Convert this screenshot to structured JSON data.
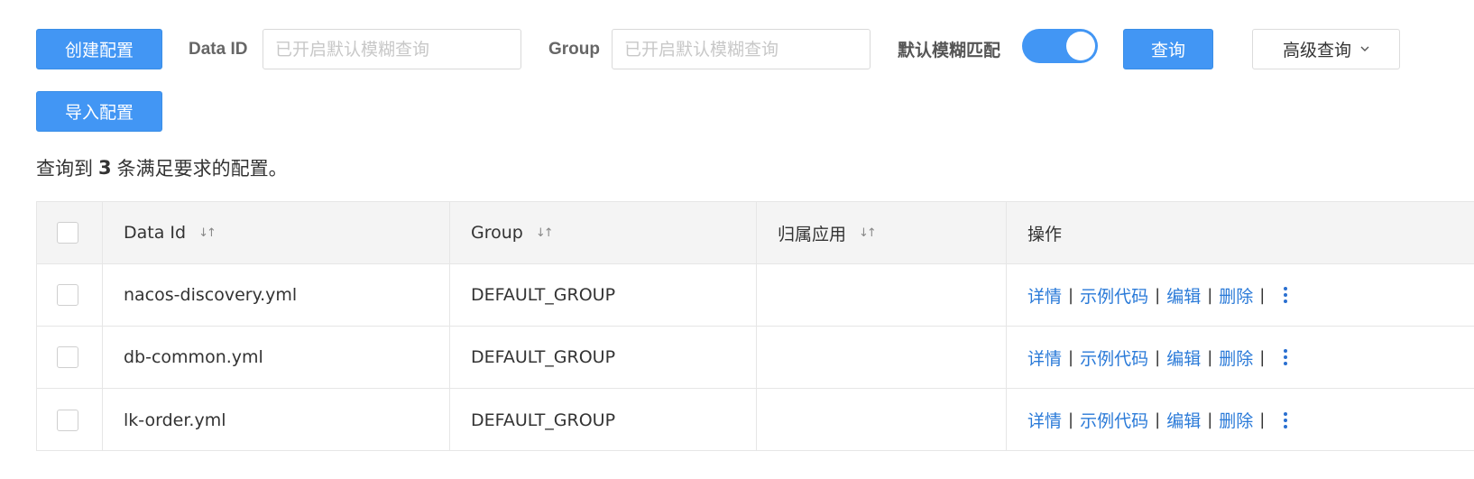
{
  "toolbar": {
    "create_button": "创建配置",
    "dataid_label": "Data ID",
    "dataid_placeholder": "已开启默认模糊查询",
    "group_label": "Group",
    "group_placeholder": "已开启默认模糊查询",
    "fuzzy_label": "默认模糊匹配",
    "fuzzy_enabled": true,
    "query_button": "查询",
    "advanced_query_button": "高级查询",
    "advanced_query_icon": "chevron-down-icon",
    "import_button": "导入配置"
  },
  "summary": {
    "prefix": "查询到",
    "count": "3",
    "suffix": "条满足要求的配置。"
  },
  "table": {
    "columns": {
      "data_id": "Data Id",
      "group": "Group",
      "app": "归属应用",
      "actions": "操作"
    },
    "sort_icon": "sort-icon",
    "rows": [
      {
        "data_id": "nacos-discovery.yml",
        "group": "DEFAULT_GROUP",
        "app": ""
      },
      {
        "data_id": "db-common.yml",
        "group": "DEFAULT_GROUP",
        "app": ""
      },
      {
        "data_id": "lk-order.yml",
        "group": "DEFAULT_GROUP",
        "app": ""
      }
    ],
    "actions": {
      "detail": "详情",
      "sample_code": "示例代码",
      "edit": "编辑",
      "delete": "删除",
      "separator": "|",
      "more_icon": "more-vertical-icon"
    }
  },
  "colors": {
    "primary": "#4296f4",
    "link": "#2a7ad8",
    "header_bg": "#f4f4f4",
    "border": "#e6e6e6"
  }
}
